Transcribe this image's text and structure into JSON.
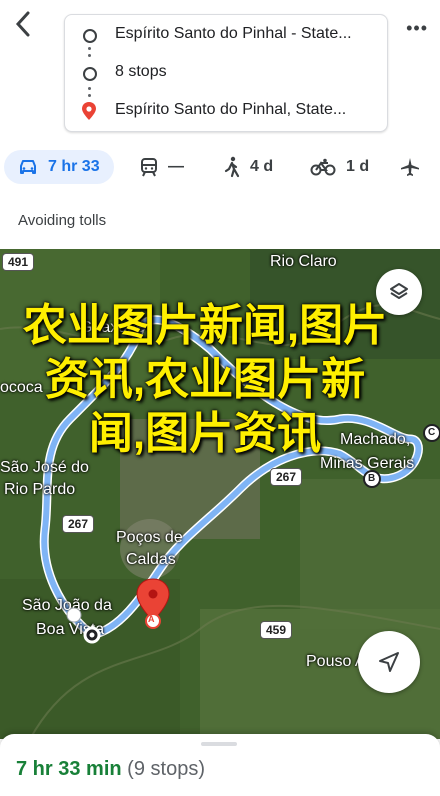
{
  "header": {
    "origin": "Espírito Santo do Pinhal - State...",
    "stops": "8 stops",
    "destination": "Espírito Santo do Pinhal, State..."
  },
  "modes": {
    "car": "7 hr 33",
    "transit": "—",
    "walk": "4 d",
    "bike": "1 d"
  },
  "route_note": "Avoiding tolls",
  "map": {
    "places": {
      "rio_claro": "Rio Claro",
      "guaxupe": "Guaxupé",
      "mococa": "ococa",
      "sao_jose": "São José do",
      "rio_pardo": "Rio Pardo",
      "pocos_1": "Poços de",
      "pocos_2": "Caldas",
      "sjbv_1": "São João da",
      "sjbv_2": "Boa Vista",
      "machado_1": "Machado,",
      "machado_2": "Minas Gerais",
      "pouso": "Pouso Alegre"
    },
    "shields": {
      "s491": "491",
      "s267a": "267",
      "s267b": "267",
      "s459": "459"
    },
    "markers": {
      "a": "A",
      "b": "B",
      "c": "C"
    },
    "overlay_text": "农业图片新闻,图片资讯,农业图片新闻,图片资讯"
  },
  "summary": {
    "time": "7 hr 33 min",
    "stops": "(9 stops)"
  },
  "colors": {
    "accent": "#1a73e8",
    "route": "#7fb4f5",
    "duration": "#188038",
    "overlay": "#ffef00",
    "pin": "#ea4335"
  }
}
